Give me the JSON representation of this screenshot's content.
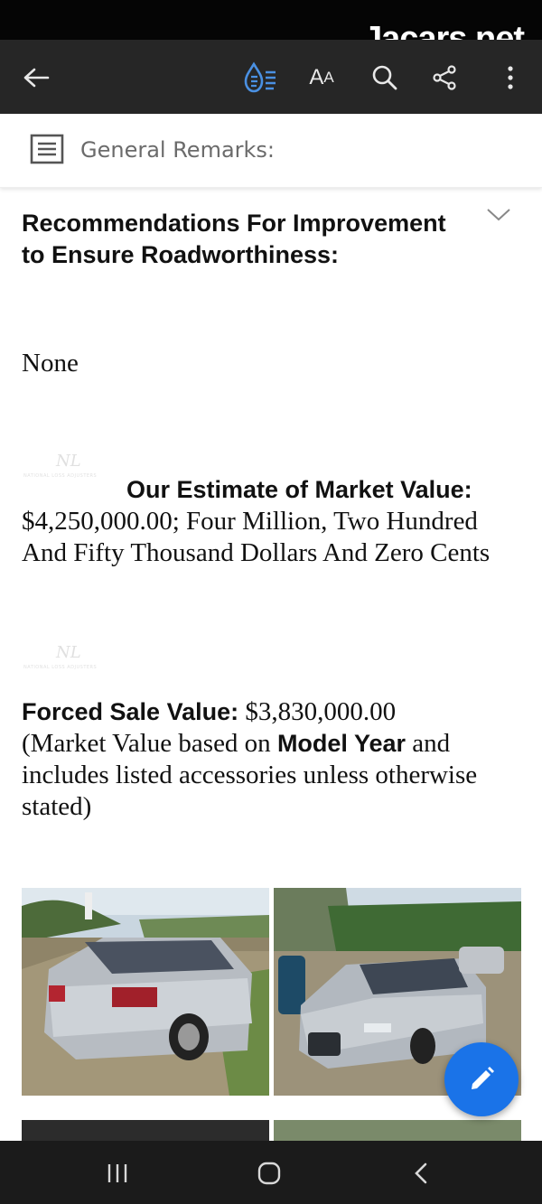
{
  "watermark": "Jacars.net",
  "toolbar": {
    "back_icon": "arrow-left-icon",
    "reflow_icon": "droplet-list-icon",
    "text_size_label_big": "A",
    "text_size_label_small": "A",
    "search_icon": "search-icon",
    "share_icon": "share-icon",
    "more_icon": "more-vertical-icon",
    "accent_color": "#4a90e2"
  },
  "remarks": {
    "label": "General Remarks:"
  },
  "content": {
    "heading": "Recommendations For Improvement to Ensure Roadworthiness:",
    "none_text": "None",
    "estimate_label": "Our Estimate of Market Value:",
    "estimate_value": "$4,250,000.00; Four Million, Two Hundred And Fifty Thousand Dollars And Zero Cents",
    "forced_label": "Forced Sale Value:",
    "forced_value": " $3,830,000.00",
    "forced_paren_start": "(Market Value based on ",
    "forced_bold": "Model Year",
    "forced_paren_end": " and includes listed accessories unless otherwise stated)",
    "logo_monogram": "NL",
    "logo_subtitle": "NATIONAL LOSS ADJUSTERS"
  },
  "fab": {
    "icon": "pencil-icon",
    "color": "#1a73e8"
  },
  "nav": {
    "recents_icon": "recents-icon",
    "home_icon": "home-icon",
    "back_icon": "back-chevron-icon"
  }
}
